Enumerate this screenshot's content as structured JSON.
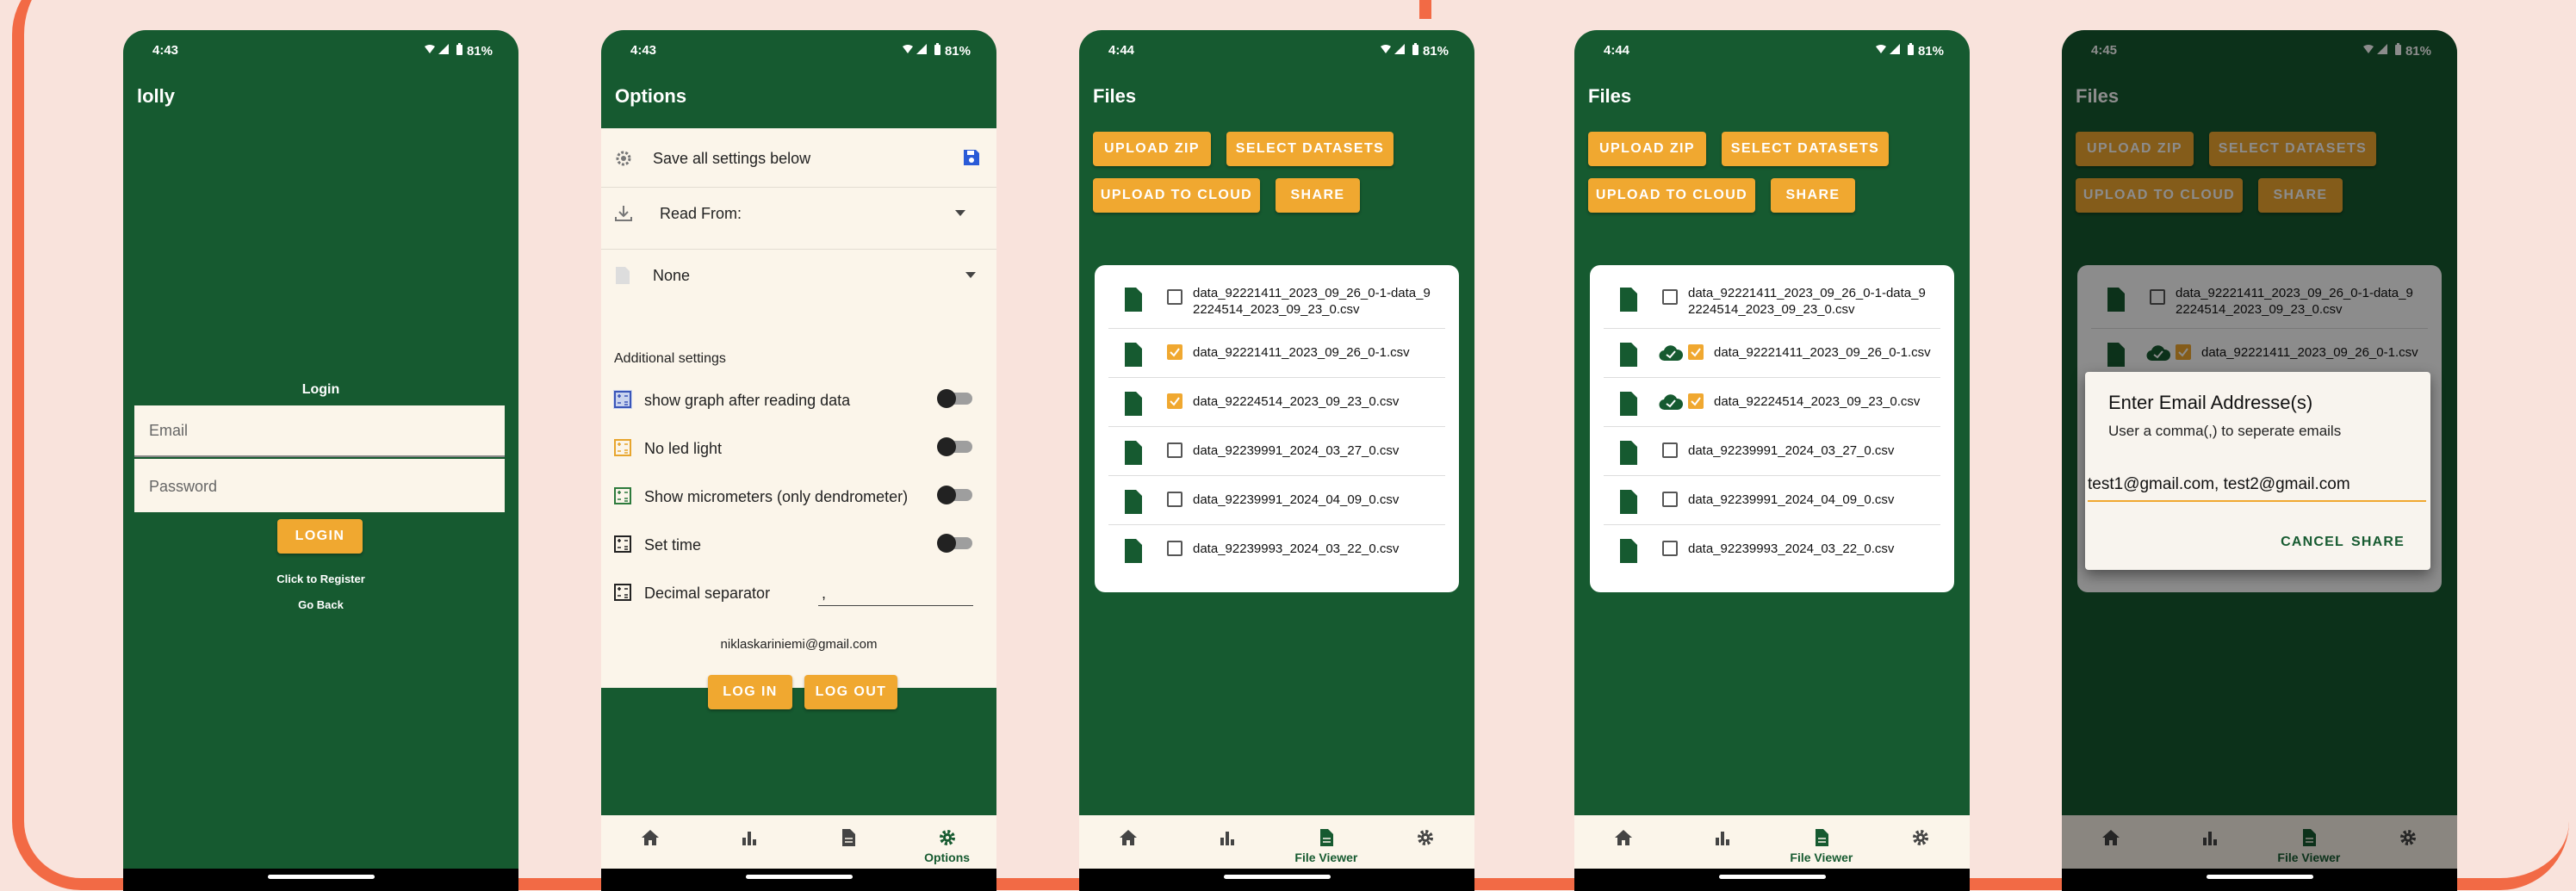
{
  "status": {
    "battery": "81%",
    "times": [
      "4:43",
      "4:43",
      "4:44",
      "4:44",
      "4:45"
    ]
  },
  "colors": {
    "green": "#165a30",
    "accent": "#f0a830",
    "background": "#f9e3dc",
    "frame": "#f26a45"
  },
  "nav": {
    "options_label": "Options",
    "fileviewer_label": "File Viewer"
  },
  "s1": {
    "title": "lolly",
    "login_heading": "Login",
    "email_placeholder": "Email",
    "password_placeholder": "Password",
    "login_button": "LOGIN",
    "register_link": "Click to Register",
    "back_link": "Go Back"
  },
  "s2": {
    "title": "Options",
    "save_label": "Save all settings below",
    "read_from_label": "Read From:",
    "none_label": "None",
    "additional_header": "Additional settings",
    "settings": [
      {
        "label": "show graph after reading data",
        "on": false
      },
      {
        "label": "No led light",
        "on": false
      },
      {
        "label": "Show micrometers (only dendrometer)",
        "on": false
      },
      {
        "label": "Set time",
        "on": false
      }
    ],
    "decimal_label": "Decimal separator",
    "decimal_value": ",",
    "account_email": "niklaskariniemi@gmail.com",
    "login_button": "LOG IN",
    "logout_button": "LOG OUT"
  },
  "files": {
    "title": "Files",
    "upload_zip": "UPLOAD ZIP",
    "select_datasets": "SELECT DATASETS",
    "upload_cloud": "UPLOAD TO CLOUD",
    "share": "SHARE",
    "items": [
      {
        "name_line1": "data_92221411_2023_09_26_0-1-data_9",
        "name_line2": "2224514_2023_09_23_0.csv",
        "checked": false
      },
      {
        "name_line1": "data_92221411_2023_09_26_0-1.csv",
        "name_line2": "",
        "checked": true
      },
      {
        "name_line1": "data_92224514_2023_09_23_0.csv",
        "name_line2": "",
        "checked": true
      },
      {
        "name_line1": "data_92239991_2024_03_27_0.csv",
        "name_line2": "",
        "checked": false
      },
      {
        "name_line1": "data_92239991_2024_04_09_0.csv",
        "name_line2": "",
        "checked": false
      },
      {
        "name_line1": "data_92239993_2024_03_22_0.csv",
        "name_line2": "",
        "checked": false
      }
    ]
  },
  "dialog": {
    "title": "Enter Email Addresse(s)",
    "hint": "User a comma(,) to seperate emails",
    "value": "test1@gmail.com, test2@gmail.com",
    "cancel": "CANCEL",
    "share": "SHARE"
  }
}
